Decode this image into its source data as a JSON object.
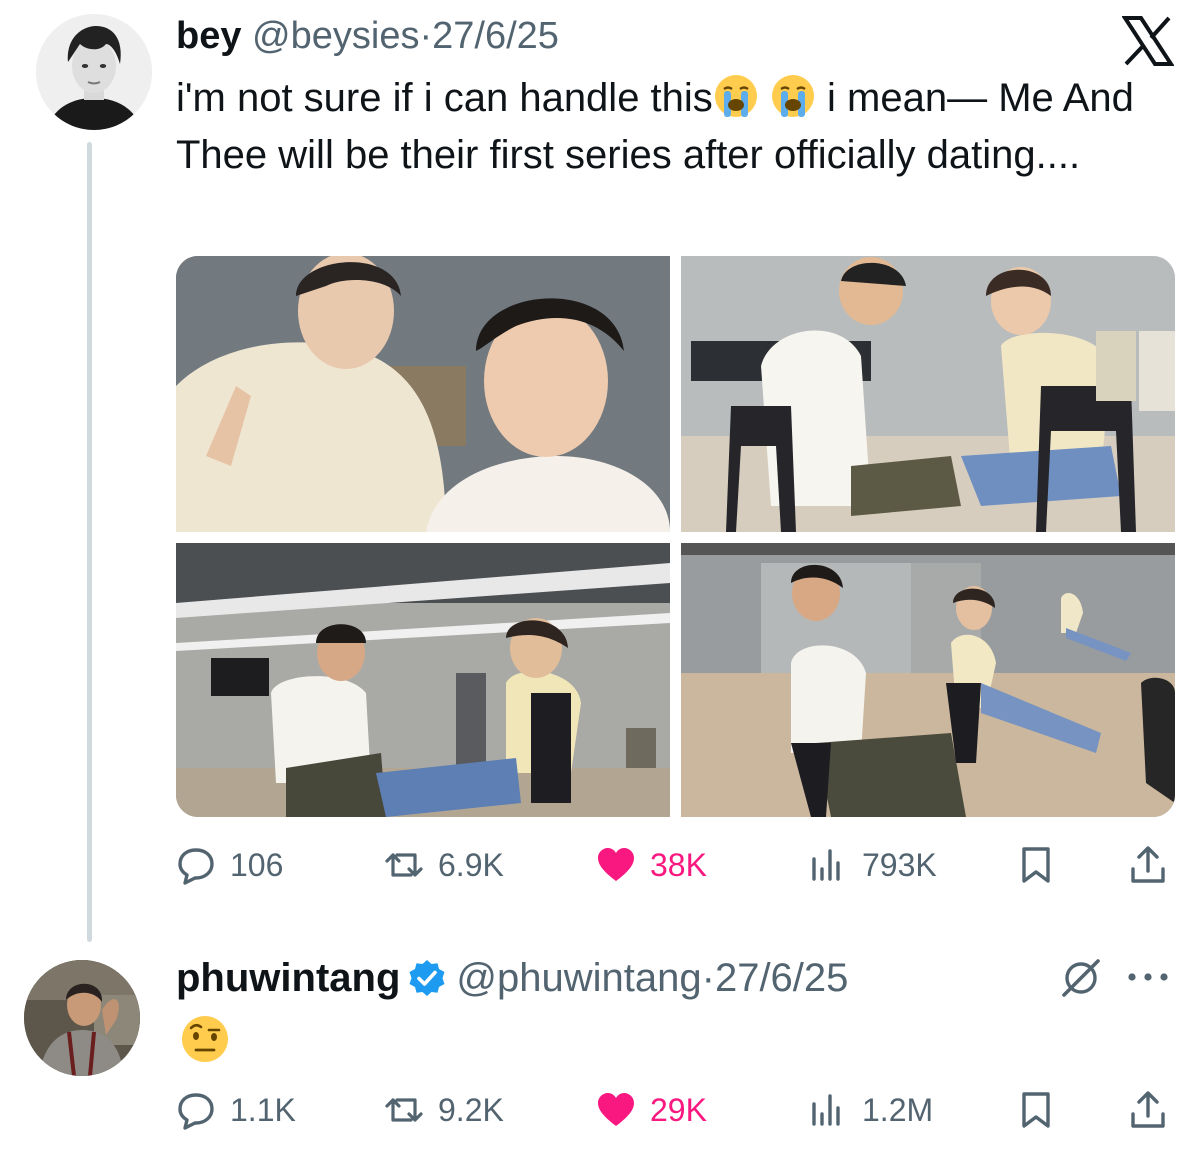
{
  "colors": {
    "text": "#0f1419",
    "secondary": "#536471",
    "like": "#f91880",
    "verified": "#1d9bf0",
    "thread_line": "#cfd9de"
  },
  "branding": {
    "logo_icon": "x-logo-icon"
  },
  "tweet1": {
    "author": {
      "name": "bey",
      "handle": "@beysies",
      "avatar_icon": "profile-photo"
    },
    "separator": "·",
    "date": "27/6/25",
    "text_part1": "i'm not sure if i can handle this",
    "text_part2": "i mean— Me And Thee will be their first series after officially dating....",
    "emojis": [
      "loudly-crying-face-emoji",
      "loudly-crying-face-emoji"
    ],
    "media": [
      "photo-1",
      "photo-2",
      "photo-3",
      "photo-4"
    ],
    "metrics": {
      "replies": "106",
      "reposts": "6.9K",
      "likes": "38K",
      "views": "793K"
    },
    "liked": true
  },
  "tweet2": {
    "author": {
      "name": "phuwintang",
      "handle": "@phuwintang",
      "verified": true,
      "avatar_icon": "profile-photo"
    },
    "separator": "·",
    "date": "27/6/25",
    "emoji": "face-with-raised-eyebrow-emoji",
    "metrics": {
      "replies": "1.1K",
      "reposts": "9.2K",
      "likes": "29K",
      "views": "1.2M"
    },
    "liked": true
  }
}
